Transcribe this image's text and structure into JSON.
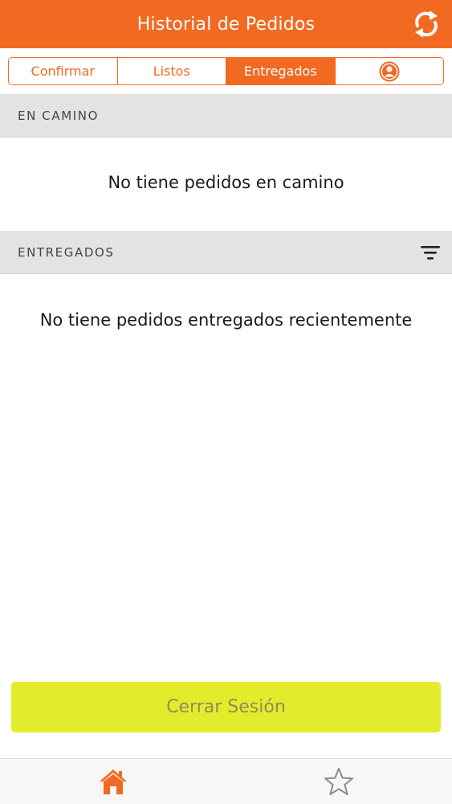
{
  "header": {
    "title": "Historial de Pedidos",
    "refresh_icon": "refresh-icon"
  },
  "tabs": [
    {
      "label": "Confirmar",
      "active": false
    },
    {
      "label": "Listos",
      "active": false
    },
    {
      "label": "Entregados",
      "active": true
    },
    {
      "label": "",
      "icon": "user-profile-icon",
      "active": false
    }
  ],
  "sections": {
    "en_camino": {
      "title": "EN CAMINO",
      "empty_message": "No tiene pedidos en camino"
    },
    "entregados": {
      "title": "ENTREGADOS",
      "filter_icon": "filter-icon",
      "empty_message": "No tiene pedidos entregados recientemente"
    }
  },
  "logout": {
    "label": "Cerrar Sesión"
  },
  "bottom_nav": [
    {
      "icon": "home-icon",
      "active": true
    },
    {
      "icon": "star-icon",
      "active": false
    }
  ],
  "colors": {
    "brand_orange": "#f26a22",
    "section_bg": "#e3e3e5",
    "logout_bg": "#e2ec2a",
    "logout_text": "#8d8d5a",
    "nav_inactive": "#8a8a8a"
  }
}
